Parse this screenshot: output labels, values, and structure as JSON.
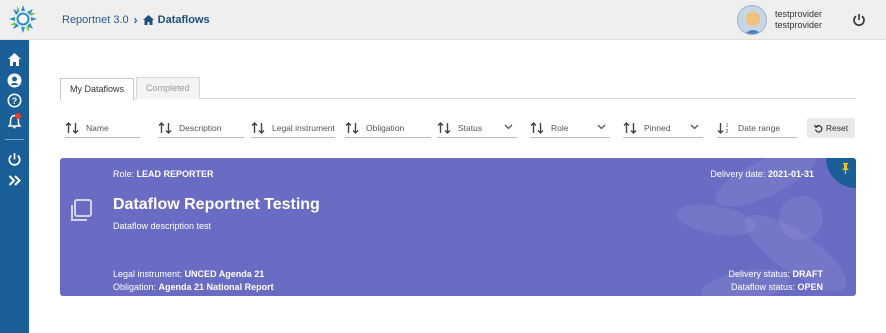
{
  "header": {
    "breadcrumb_root": "Reportnet 3.0",
    "breadcrumb_current": "Dataflows",
    "user_name_1": "testprovider",
    "user_name_2": "testprovider"
  },
  "tabs": [
    "My Dataflows",
    "Completed"
  ],
  "filters": [
    {
      "label": "Name",
      "kind": "sort"
    },
    {
      "label": "Description",
      "kind": "sort"
    },
    {
      "label": "Legal instrument",
      "kind": "sort"
    },
    {
      "label": "Obligation",
      "kind": "sort"
    },
    {
      "label": "Status",
      "kind": "dropdown"
    },
    {
      "label": "Role",
      "kind": "dropdown"
    },
    {
      "label": "Pinned",
      "kind": "dropdown"
    },
    {
      "label": "Date range",
      "kind": "date"
    }
  ],
  "reset_label": "Reset",
  "card": {
    "role_label": "Role:",
    "role_value": "LEAD REPORTER",
    "delivery_label": "Delivery date:",
    "delivery_value": "2021-01-31",
    "title": "Dataflow Reportnet Testing",
    "description": "Dataflow description test",
    "legal_label": "Legal instrument:",
    "legal_value": "UNCED Agenda 21",
    "obligation_label": "Obligation:",
    "obligation_value": "Agenda 21 National Report",
    "delivery_status_label": "Delivery status:",
    "delivery_status_value": "DRAFT",
    "dataflow_status_label": "Dataflow status:",
    "dataflow_status_value": "OPEN",
    "pinned": true
  },
  "colors": {
    "sidebar": "#1b5f98",
    "card": "#6a6cc4",
    "pin": "#f5c518"
  },
  "icons": [
    "reportnet-logo-icon",
    "home-icon",
    "user-icon",
    "help-icon",
    "bell-icon",
    "power-icon",
    "double-chevron-right-icon",
    "sort-icon",
    "chevron-down-icon",
    "sort-date-icon",
    "undo-icon",
    "copy-icon",
    "pin-icon"
  ]
}
